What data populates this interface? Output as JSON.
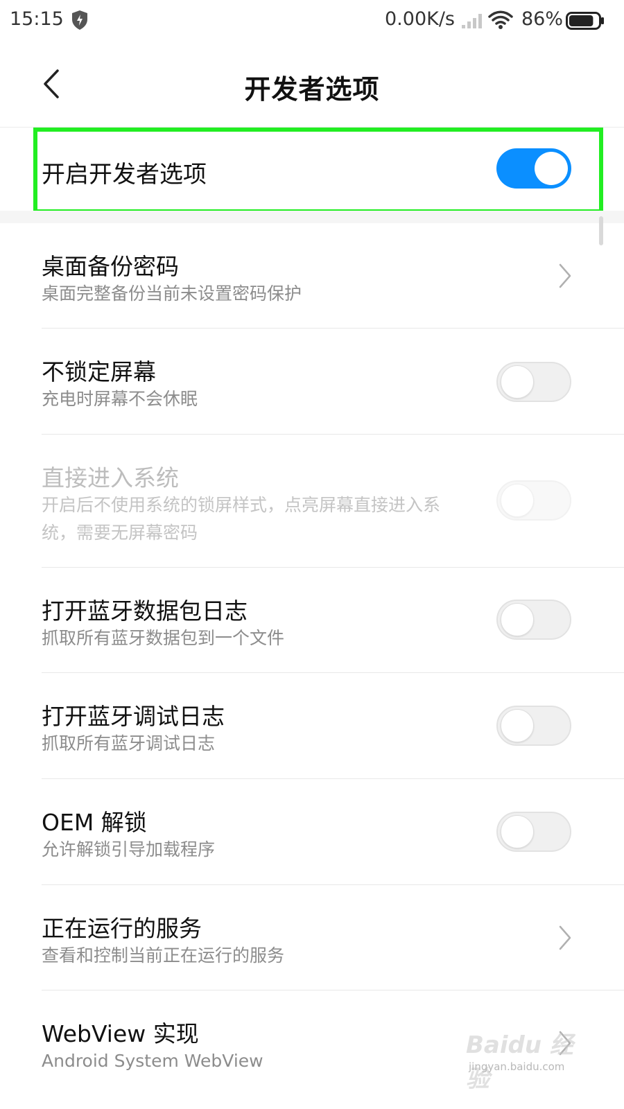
{
  "status_bar": {
    "time": "15:15",
    "network_speed": "0.00K/s",
    "battery_percent": "86%",
    "battery_level": 0.86,
    "icons": [
      "shield-icon",
      "signal-icon",
      "wifi-icon",
      "battery-icon"
    ]
  },
  "header": {
    "back_icon": "chevron-left-icon",
    "title": "开发者选项"
  },
  "master_toggle": {
    "label": "开启开发者选项",
    "state": "on"
  },
  "settings": [
    {
      "title": "桌面备份密码",
      "subtitle": "桌面完整备份当前未设置密码保护",
      "control": "chevron",
      "enabled": true
    },
    {
      "title": "不锁定屏幕",
      "subtitle": "充电时屏幕不会休眠",
      "control": "toggle",
      "state": "off",
      "enabled": true
    },
    {
      "title": "直接进入系统",
      "subtitle": "开启后不使用系统的锁屏样式，点亮屏幕直接进入系统，需要无屏幕密码",
      "control": "toggle",
      "state": "off",
      "enabled": false
    },
    {
      "title": "打开蓝牙数据包日志",
      "subtitle": "抓取所有蓝牙数据包到一个文件",
      "control": "toggle",
      "state": "off",
      "enabled": true
    },
    {
      "title": "打开蓝牙调试日志",
      "subtitle": "抓取所有蓝牙调试日志",
      "control": "toggle",
      "state": "off",
      "enabled": true
    },
    {
      "title": "OEM 解锁",
      "subtitle": "允许解锁引导加载程序",
      "control": "toggle",
      "state": "off",
      "enabled": true
    },
    {
      "title": "正在运行的服务",
      "subtitle": "查看和控制当前正在运行的服务",
      "control": "chevron",
      "enabled": true
    },
    {
      "title": "WebView 实现",
      "subtitle": "Android System WebView",
      "control": "chevron",
      "enabled": true
    }
  ],
  "colors": {
    "accent": "#0b8fff",
    "highlight_box": "#22ee22",
    "text_primary": "#111111",
    "text_secondary": "#8c8c8c"
  },
  "watermark": {
    "brand": "Baidu 经验",
    "url": "jingyan.baidu.com"
  }
}
